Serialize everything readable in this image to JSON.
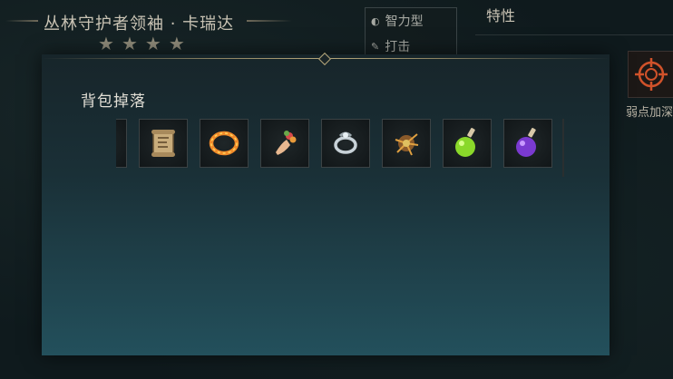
{
  "header": {
    "boss_name": "丛林守护者领袖 · 卡瑞达",
    "stars": 4
  },
  "type_panel": {
    "rows": [
      {
        "icon": "mind-icon",
        "label": "智力型"
      },
      {
        "icon": "strike-icon",
        "label": "打击"
      }
    ]
  },
  "traits": {
    "title": "特性",
    "weak_label": "弱点加深"
  },
  "modal": {
    "title": "背包掉落",
    "items": [
      {
        "name": "partial-item-icon",
        "color": "#4a7a6a"
      },
      {
        "name": "scroll-icon",
        "color": "#b89a6a"
      },
      {
        "name": "fire-ring-icon",
        "color": "#e07a2a"
      },
      {
        "name": "flower-bouquet-icon",
        "color": "#d8a070"
      },
      {
        "name": "silver-ring-icon",
        "color": "#b8c2c8"
      },
      {
        "name": "feather-charm-icon",
        "color": "#c88a3a"
      },
      {
        "name": "green-potion-icon",
        "color": "#8ad82a"
      },
      {
        "name": "purple-potion-icon",
        "color": "#8a4ad8"
      }
    ]
  }
}
